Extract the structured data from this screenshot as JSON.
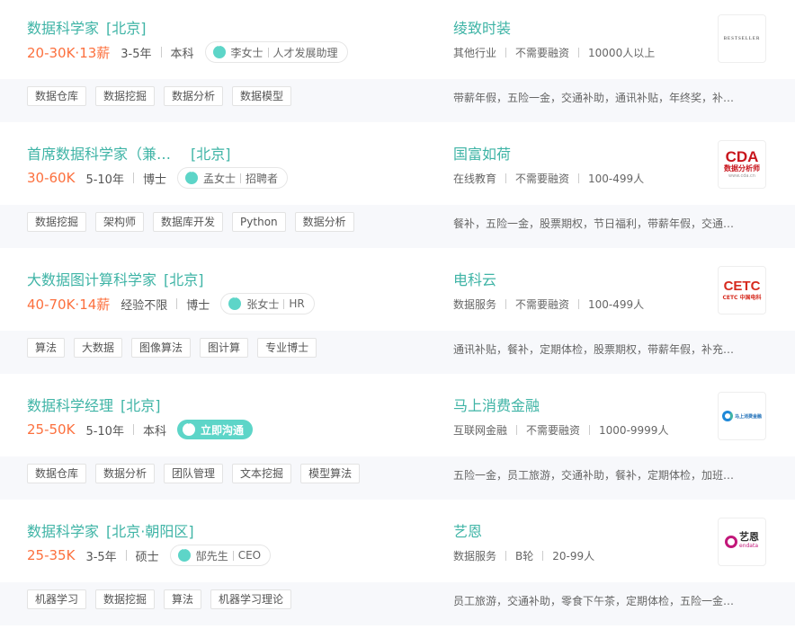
{
  "jobs": [
    {
      "title": "数据科学家",
      "city": "[北京]",
      "salary": "20-30K·13薪",
      "experience": "3-5年",
      "education": "本科",
      "recruiter_name": "李女士",
      "recruiter_role": "人才发展助理",
      "company": "绫致时装",
      "industry": "其他行业",
      "funding": "不需要融资",
      "size": "10000人以上",
      "tags": [
        "数据仓库",
        "数据挖掘",
        "数据分析",
        "数据模型"
      ],
      "benefits": "带薪年假，五险一金，交通补助，通讯补贴，年终奖，补…",
      "logo_text": "BESTSELLER"
    },
    {
      "title": "首席数据科学家（兼…",
      "city": "[北京]",
      "salary": "30-60K",
      "experience": "5-10年",
      "education": "博士",
      "recruiter_name": "孟女士",
      "recruiter_role": "招聘者",
      "company": "国富如荷",
      "industry": "在线教育",
      "funding": "不需要融资",
      "size": "100-499人",
      "tags": [
        "数据挖掘",
        "架构师",
        "数据库开发",
        "Python",
        "数据分析"
      ],
      "benefits": "餐补，五险一金，股票期权，节日福利，带薪年假，交通…",
      "logo_text": "CDA",
      "logo_sub": "数据分析师",
      "logo_url": "www.cda.cn"
    },
    {
      "title": "大数据图计算科学家",
      "city": "[北京]",
      "salary": "40-70K·14薪",
      "experience": "经验不限",
      "education": "博士",
      "recruiter_name": "张女士",
      "recruiter_role": "HR",
      "company": "电科云",
      "industry": "数据服务",
      "funding": "不需要融资",
      "size": "100-499人",
      "tags": [
        "算法",
        "大数据",
        "图像算法",
        "图计算",
        "专业博士"
      ],
      "benefits": "通讯补贴，餐补，定期体检，股票期权，带薪年假，补充…",
      "logo_text": "CETC",
      "logo_sub": "CETC 中国电科"
    },
    {
      "title": "数据科学经理",
      "city": "[北京]",
      "salary": "25-50K",
      "experience": "5-10年",
      "education": "本科",
      "chat_label": "立即沟通",
      "company": "马上消费金融",
      "industry": "互联网金融",
      "funding": "不需要融资",
      "size": "1000-9999人",
      "tags": [
        "数据仓库",
        "数据分析",
        "团队管理",
        "文本挖掘",
        "模型算法"
      ],
      "benefits": "五险一金，员工旅游，交通补助，餐补，定期体检，加班…",
      "logo_text": "马上消费金融"
    },
    {
      "title": "数据科学家",
      "city": "[北京·朝阳区]",
      "salary": "25-35K",
      "experience": "3-5年",
      "education": "硕士",
      "recruiter_name": "郜先生",
      "recruiter_role": "CEO",
      "company": "艺恩",
      "industry": "数据服务",
      "funding": "B轮",
      "size": "20-99人",
      "tags": [
        "机器学习",
        "数据挖掘",
        "算法",
        "机器学习理论"
      ],
      "benefits": "员工旅游，交通补助，零食下午茶，定期体检，五险一金…",
      "logo_text": "艺恩",
      "logo_sub": "endata"
    }
  ],
  "colors": {
    "title": "#3fb4a6",
    "salary": "#fc703e",
    "accent": "#5dd5c8"
  }
}
